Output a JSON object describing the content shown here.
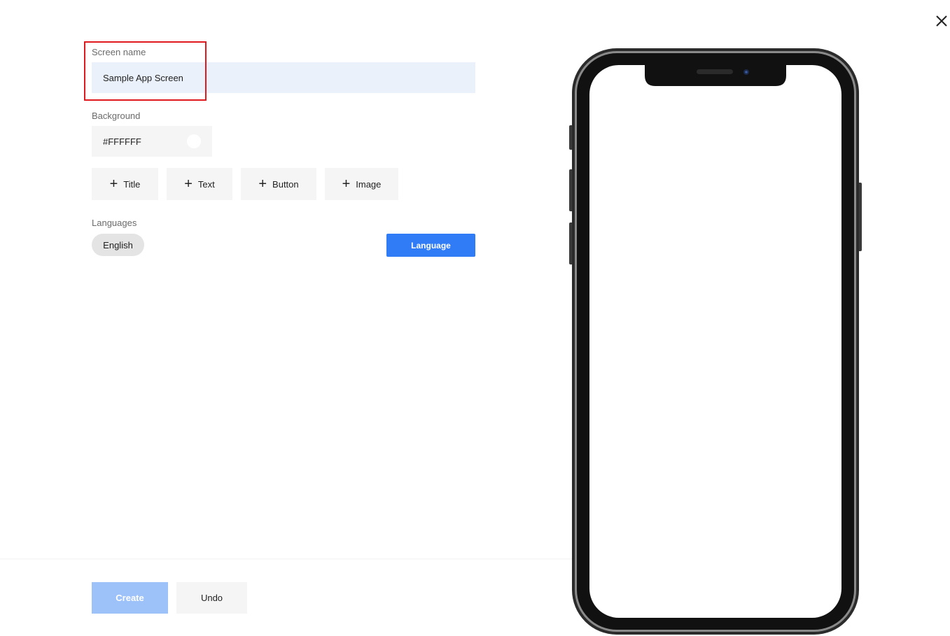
{
  "form": {
    "screen_name_label": "Screen name",
    "screen_name_value": "Sample App Screen",
    "background_label": "Background",
    "background_value": "#FFFFFF",
    "add_buttons": [
      {
        "label": "Title"
      },
      {
        "label": "Text"
      },
      {
        "label": "Button"
      },
      {
        "label": "Image"
      }
    ],
    "languages_label": "Languages",
    "language_chip": "English",
    "language_button": "Language"
  },
  "footer": {
    "create_label": "Create",
    "undo_label": "Undo"
  },
  "icons": {
    "close": "close-icon",
    "plus": "plus-icon"
  },
  "colors": {
    "accent": "#2f7cf6",
    "accent_disabled": "#9dc1f9",
    "input_bg": "#eaf1fb",
    "highlight": "#e0191e"
  }
}
